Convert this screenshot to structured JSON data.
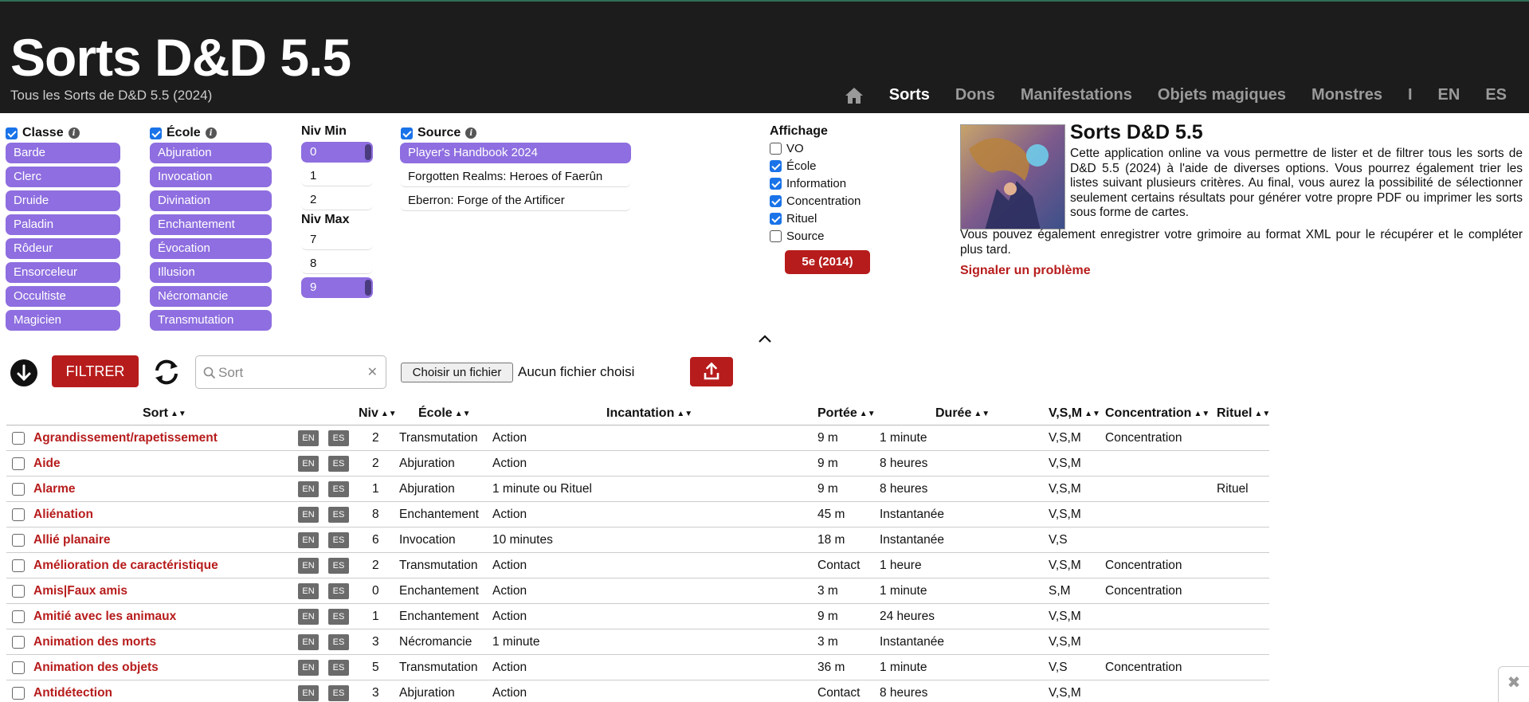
{
  "header": {
    "title": "Sorts D&D 5.5",
    "subtitle": "Tous les Sorts de D&D 5.5 (2024)",
    "nav": [
      "Sorts",
      "Dons",
      "Manifestations",
      "Objets magiques",
      "Monstres",
      "I",
      "EN",
      "ES"
    ],
    "nav_active": "Sorts"
  },
  "filters": {
    "classe": {
      "label": "Classe",
      "items": [
        "Barde",
        "Clerc",
        "Druide",
        "Paladin",
        "Rôdeur",
        "Ensorceleur",
        "Occultiste",
        "Magicien"
      ]
    },
    "ecole": {
      "label": "École",
      "items": [
        "Abjuration",
        "Invocation",
        "Divination",
        "Enchantement",
        "Évocation",
        "Illusion",
        "Nécromancie",
        "Transmutation"
      ]
    },
    "niv_min": {
      "label": "Niv Min",
      "items": [
        "0",
        "1",
        "2"
      ],
      "selected": "0"
    },
    "niv_max": {
      "label": "Niv Max",
      "items": [
        "7",
        "8",
        "9"
      ],
      "selected": "9"
    },
    "source": {
      "label": "Source",
      "items": [
        "Player's Handbook 2024",
        "Forgotten Realms: Heroes of Faerûn",
        "Eberron: Forge of the Artificer"
      ],
      "selected": "Player's Handbook 2024"
    }
  },
  "affichage": {
    "label": "Affichage",
    "options": [
      {
        "label": "VO",
        "checked": false
      },
      {
        "label": "École",
        "checked": true
      },
      {
        "label": "Information",
        "checked": true
      },
      {
        "label": "Concentration",
        "checked": true
      },
      {
        "label": "Rituel",
        "checked": true
      },
      {
        "label": "Source",
        "checked": false
      }
    ],
    "edition_button": "5e (2014)"
  },
  "about": {
    "title": "Sorts D&D 5.5",
    "p1": "Cette application online va vous permettre de lister et de filtrer tous les sorts de D&D 5.5 (2024) à l'aide de diverses options. Vous pourrez également trier les listes suivant plusieurs critères. Au final, vous aurez la possibilité de sélectionner seulement certains résultats pour générer votre propre PDF ou imprimer les sorts sous forme de cartes.",
    "p2": "Vous pouvez également enregistrer votre grimoire au format XML pour le récupérer et le compléter plus tard.",
    "report": "Signaler un problème"
  },
  "toolbar": {
    "filter_label": "FILTRER",
    "search_placeholder": "Sort",
    "file_button": "Choisir un fichier",
    "file_status": "Aucun fichier choisi"
  },
  "table": {
    "headers": {
      "sort": "Sort",
      "niv": "Niv",
      "ecole": "École",
      "incantation": "Incantation",
      "portee": "Portée",
      "duree": "Durée",
      "vsm": "V,S,M",
      "concentration": "Concentration",
      "rituel": "Rituel"
    },
    "badges": {
      "en": "EN",
      "es": "ES"
    },
    "rows": [
      {
        "name": "Agrandissement/rapetissement",
        "niv": "2",
        "ecole": "Transmutation",
        "incantation": "Action",
        "portee": "9 m",
        "duree": "1 minute",
        "vsm": "V,S,M",
        "concentration": "Concentration",
        "rituel": ""
      },
      {
        "name": "Aide",
        "niv": "2",
        "ecole": "Abjuration",
        "incantation": "Action",
        "portee": "9 m",
        "duree": "8 heures",
        "vsm": "V,S,M",
        "concentration": "",
        "rituel": ""
      },
      {
        "name": "Alarme",
        "niv": "1",
        "ecole": "Abjuration",
        "incantation": "1 minute ou Rituel",
        "portee": "9 m",
        "duree": "8 heures",
        "vsm": "V,S,M",
        "concentration": "",
        "rituel": "Rituel"
      },
      {
        "name": "Aliénation",
        "niv": "8",
        "ecole": "Enchantement",
        "incantation": "Action",
        "portee": "45 m",
        "duree": "Instantanée",
        "vsm": "V,S,M",
        "concentration": "",
        "rituel": ""
      },
      {
        "name": "Allié planaire",
        "niv": "6",
        "ecole": "Invocation",
        "incantation": "10 minutes",
        "portee": "18 m",
        "duree": "Instantanée",
        "vsm": "V,S",
        "concentration": "",
        "rituel": ""
      },
      {
        "name": "Amélioration de caractéristique",
        "niv": "2",
        "ecole": "Transmutation",
        "incantation": "Action",
        "portee": "Contact",
        "duree": "1 heure",
        "vsm": "V,S,M",
        "concentration": "Concentration",
        "rituel": ""
      },
      {
        "name": "Amis|Faux amis",
        "niv": "0",
        "ecole": "Enchantement",
        "incantation": "Action",
        "portee": "3 m",
        "duree": "1 minute",
        "vsm": "S,M",
        "concentration": "Concentration",
        "rituel": ""
      },
      {
        "name": "Amitié avec les animaux",
        "niv": "1",
        "ecole": "Enchantement",
        "incantation": "Action",
        "portee": "9 m",
        "duree": "24 heures",
        "vsm": "V,S,M",
        "concentration": "",
        "rituel": ""
      },
      {
        "name": "Animation des morts",
        "niv": "3",
        "ecole": "Nécromancie",
        "incantation": "1 minute",
        "portee": "3 m",
        "duree": "Instantanée",
        "vsm": "V,S,M",
        "concentration": "",
        "rituel": ""
      },
      {
        "name": "Animation des objets",
        "niv": "5",
        "ecole": "Transmutation",
        "incantation": "Action",
        "portee": "36 m",
        "duree": "1 minute",
        "vsm": "V,S",
        "concentration": "Concentration",
        "rituel": ""
      },
      {
        "name": "Antidétection",
        "niv": "3",
        "ecole": "Abjuration",
        "incantation": "Action",
        "portee": "Contact",
        "duree": "8 heures",
        "vsm": "V,S,M",
        "concentration": "",
        "rituel": ""
      }
    ]
  },
  "colors": {
    "header_bg": "#1c1c1c",
    "accent_red": "#b71c1c",
    "pill_purple": "#8e6ee0",
    "badge_gray": "#6b6b6b"
  }
}
